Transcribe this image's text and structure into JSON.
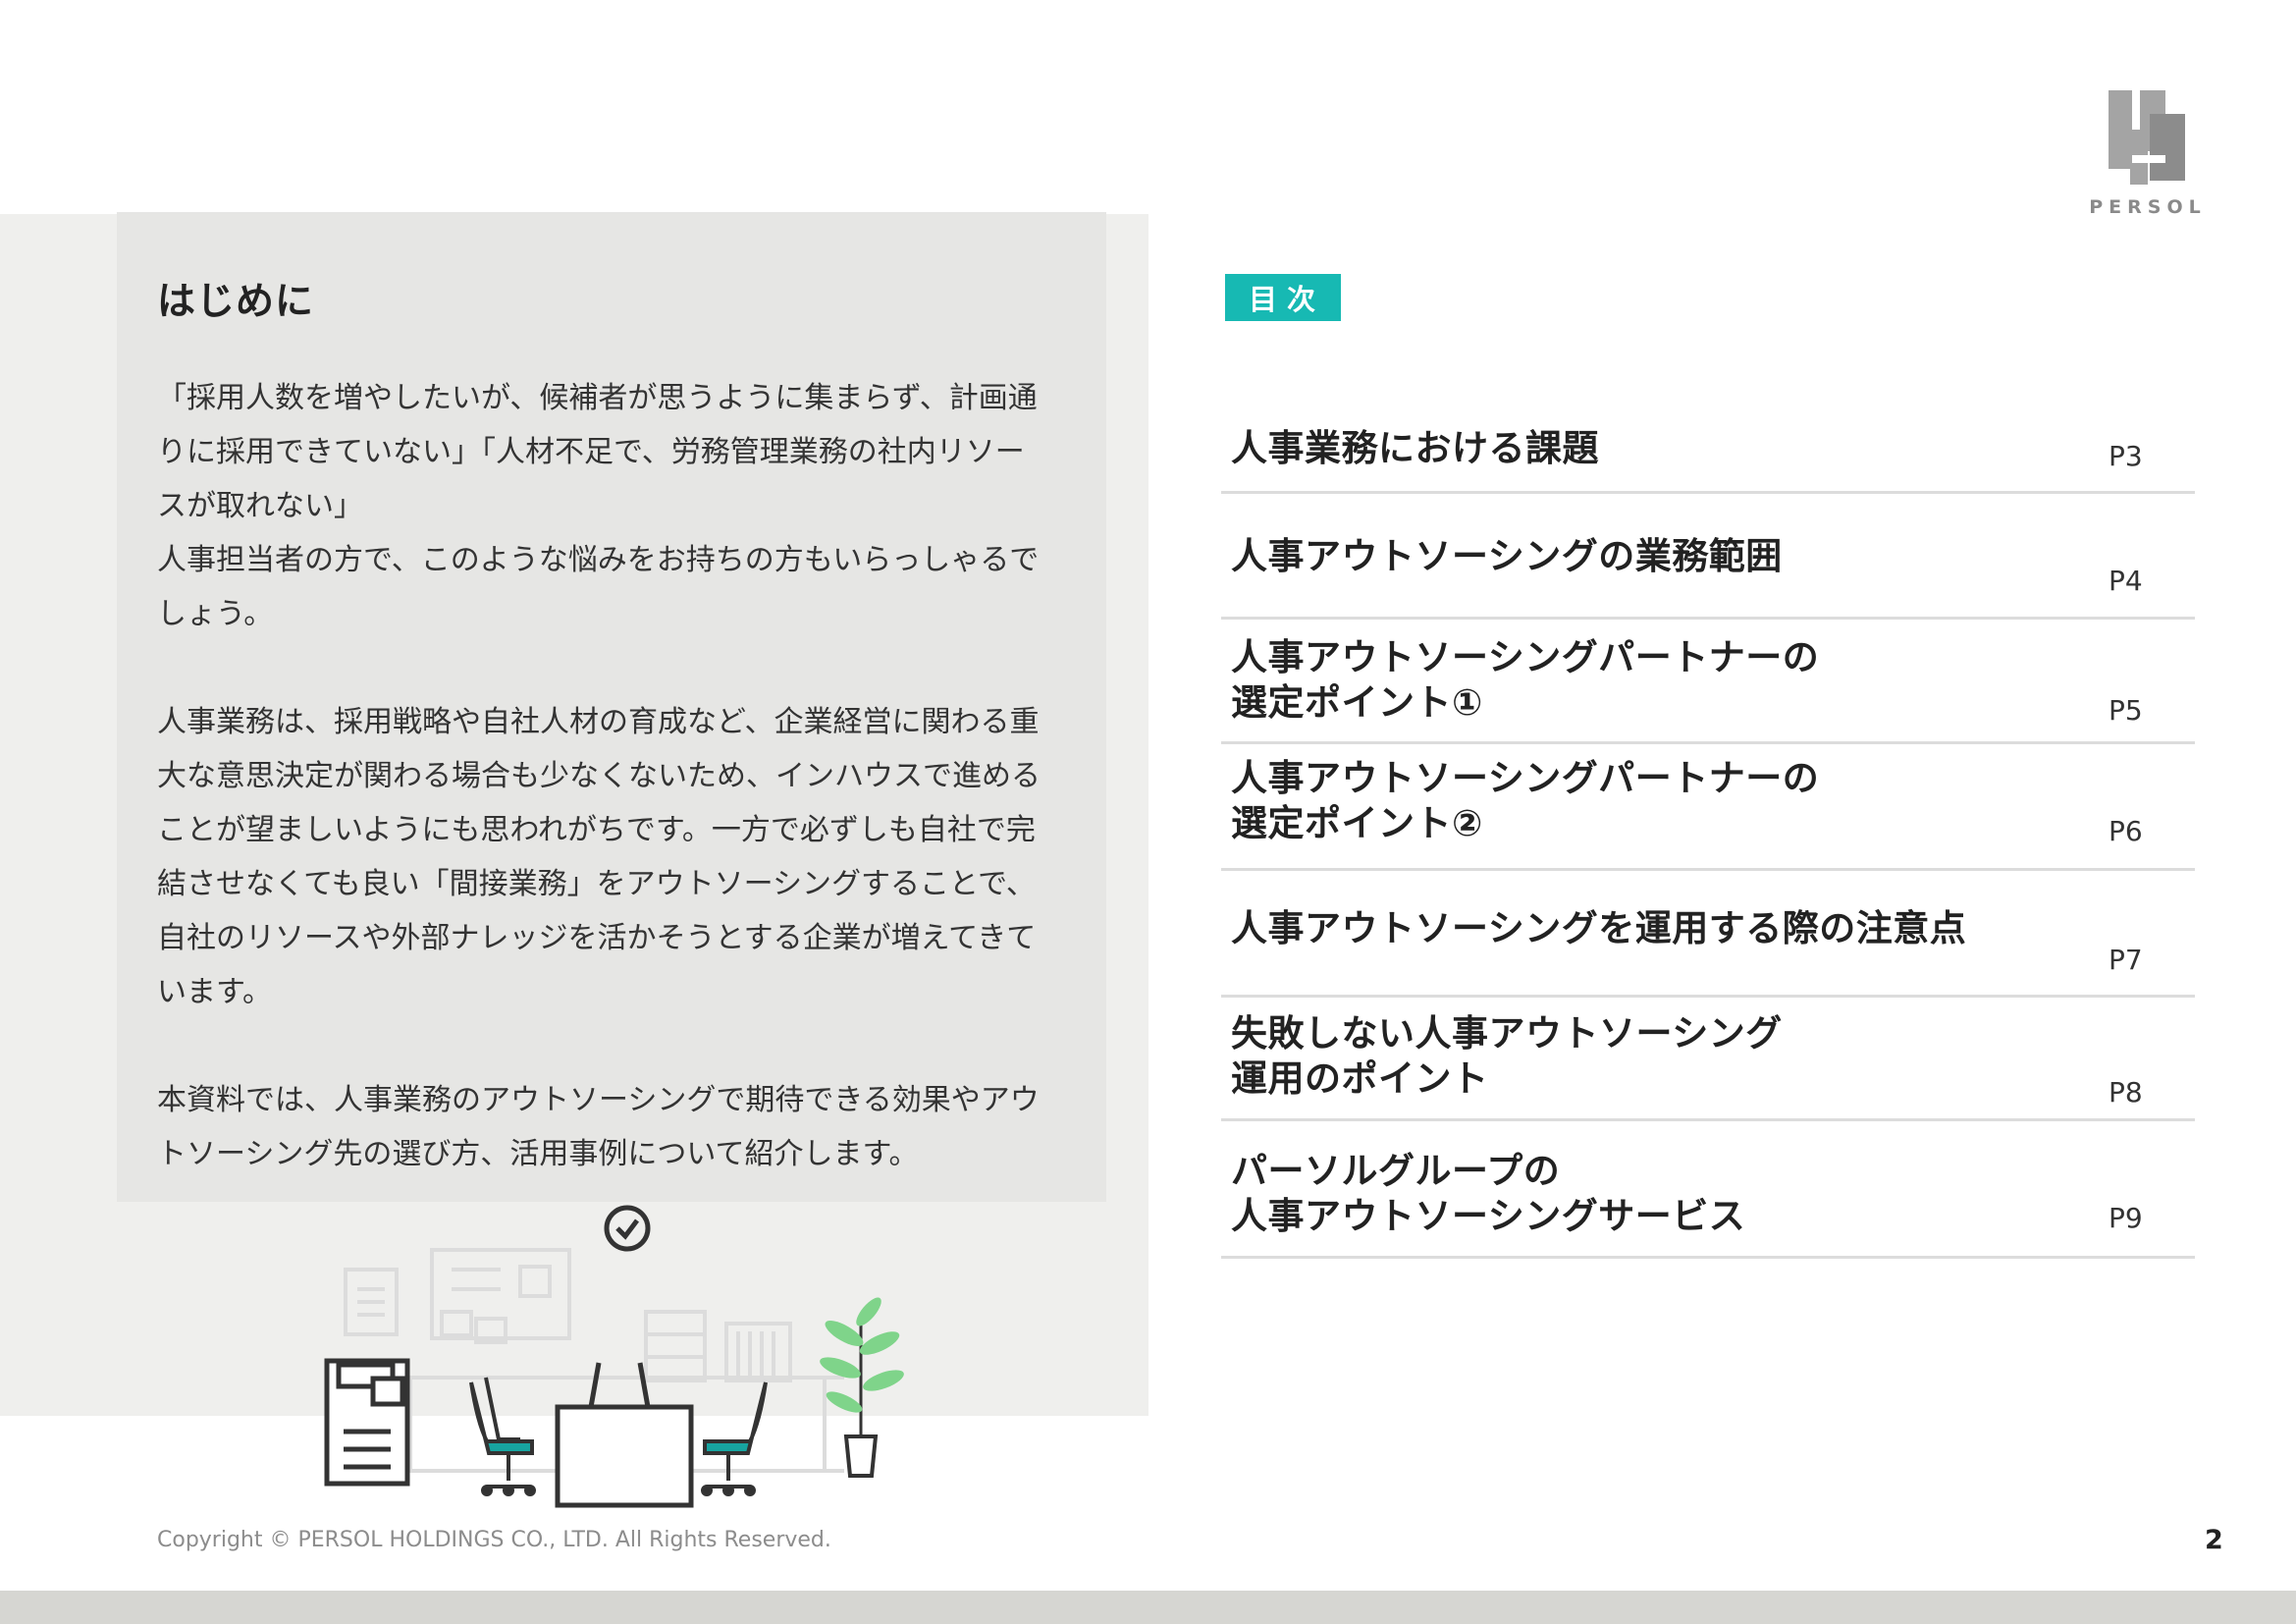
{
  "logo": {
    "text": "PERSOL"
  },
  "intro": {
    "title": "はじめに",
    "paragraphs": [
      "「採用人数を増やしたいが、候補者が思うように集まらず、計画通\nりに採用できていない」「人材不足で、労務管理業務の社内リソー\nスが取れない」\n人事担当者の方で、このような悩みをお持ちの方もいらっしゃるで\nしょう。",
      "人事業務は、採用戦略や自社人材の育成など、企業経営に関わる重\n大な意思決定が関わる場合も少なくないため、インハウスで進める\nことが望ましいようにも思われがちです。一方で必ずしも自社で完\n結させなくても良い「間接業務」をアウトソーシングすることで、\n自社のリソースや外部ナレッジを活かそうとする企業が増えてきて\nいます。",
      "本資料では、人事業務のアウトソーシングで期待できる効果やアウ\nトソーシング先の選び方、活用事例について紹介します。"
    ]
  },
  "toc": {
    "badge": "目次",
    "items": [
      {
        "title": "人事業務における課題",
        "page": "P3"
      },
      {
        "title": "人事アウトソーシングの業務範囲",
        "page": "P4"
      },
      {
        "title": "人事アウトソーシングパートナーの\n選定ポイント①",
        "page": "P5"
      },
      {
        "title": "人事アウトソーシングパートナーの\n選定ポイント②",
        "page": "P6"
      },
      {
        "title": "人事アウトソーシングを運用する際の注意点",
        "page": "P7"
      },
      {
        "title": "失敗しない人事アウトソーシング\n運用のポイント",
        "page": "P8"
      },
      {
        "title": "パーソルグループの\n人事アウトソーシングサービス",
        "page": "P9"
      }
    ]
  },
  "footer": {
    "copyright": "Copyright © PERSOL HOLDINGS CO., LTD. All Rights Reserved.",
    "page_number": "2"
  },
  "colors": {
    "accent": "#17b9b3",
    "panel": "#e6e6e4",
    "band": "#efefed"
  },
  "illustration": {
    "icons": [
      "clock-icon",
      "copier-icon",
      "office-chair-icon",
      "desk-icon",
      "plant-icon",
      "whiteboard-icon",
      "cabinet-icon",
      "bookshelf-icon"
    ]
  }
}
